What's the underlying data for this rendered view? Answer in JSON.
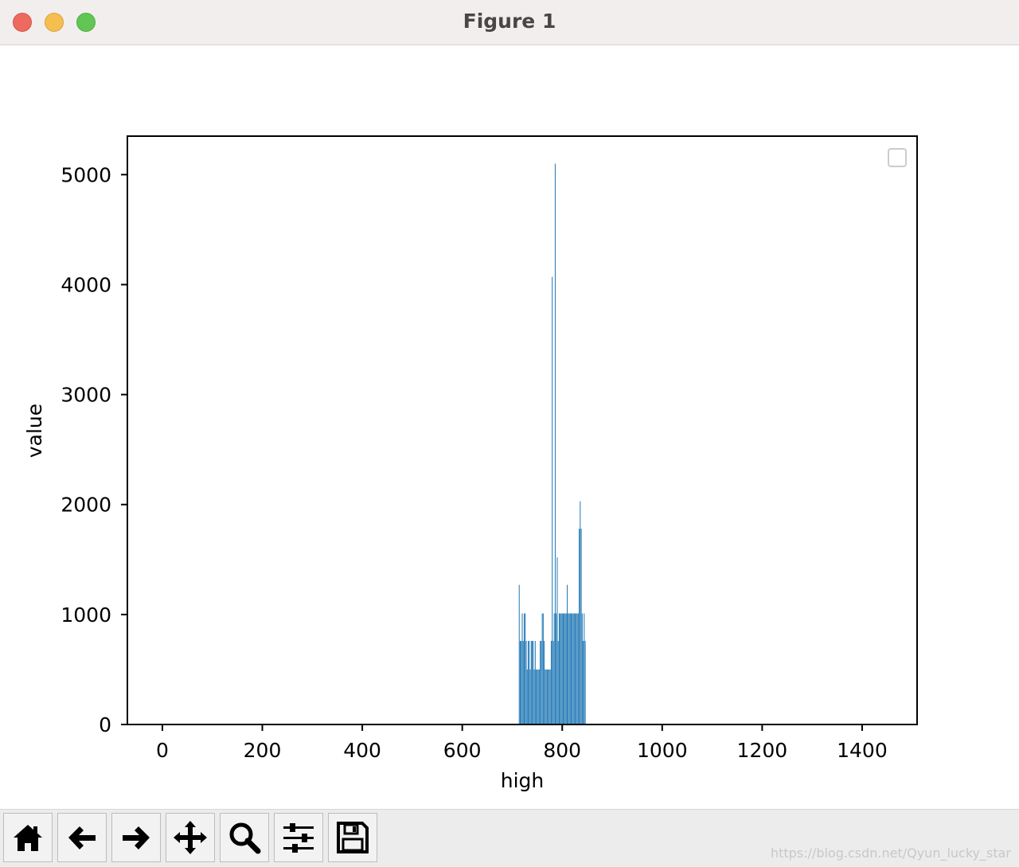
{
  "window": {
    "title": "Figure 1",
    "buttons": [
      "close",
      "minimize",
      "maximize"
    ]
  },
  "toolbar": {
    "tools": [
      {
        "name": "home-icon"
      },
      {
        "name": "back-icon"
      },
      {
        "name": "forward-icon"
      },
      {
        "name": "pan-icon"
      },
      {
        "name": "zoom-icon"
      },
      {
        "name": "subplots-config-icon"
      },
      {
        "name": "save-icon"
      }
    ]
  },
  "watermark": "https://blog.csdn.net/Qyun_lucky_star",
  "chart_data": {
    "type": "bar",
    "xlabel": "high",
    "ylabel": "value",
    "xlim": [
      -70,
      1510
    ],
    "ylim": [
      0,
      5350
    ],
    "xticks": [
      0,
      200,
      400,
      600,
      800,
      1000,
      1200,
      1400
    ],
    "yticks": [
      0,
      1000,
      2000,
      3000,
      4000,
      5000
    ],
    "legend": "top-right (empty)",
    "grid": false,
    "color": "#1f77b4",
    "x": [
      714,
      716,
      718,
      720,
      722,
      724,
      726,
      728,
      730,
      732,
      734,
      736,
      738,
      740,
      742,
      744,
      746,
      748,
      750,
      752,
      754,
      756,
      758,
      760,
      762,
      764,
      766,
      768,
      770,
      772,
      774,
      776,
      778,
      780,
      782,
      784,
      786,
      788,
      790,
      792,
      794,
      796,
      798,
      800,
      802,
      804,
      806,
      808,
      810,
      812,
      814,
      816,
      818,
      820,
      822,
      824,
      826,
      828,
      830,
      832,
      834,
      836,
      838,
      840,
      842,
      844,
      846
    ],
    "values": [
      1270,
      760,
      760,
      1010,
      760,
      1010,
      1010,
      760,
      500,
      760,
      760,
      500,
      760,
      760,
      760,
      500,
      760,
      500,
      500,
      500,
      500,
      760,
      760,
      1010,
      1010,
      760,
      500,
      500,
      500,
      500,
      500,
      500,
      760,
      4070,
      760,
      1010,
      5100,
      1010,
      1520,
      760,
      1010,
      1010,
      1010,
      1010,
      1010,
      1010,
      1010,
      1010,
      1270,
      1010,
      1010,
      1010,
      1010,
      1010,
      1010,
      1010,
      1010,
      1010,
      1010,
      1010,
      1780,
      2030,
      1780,
      1010,
      760,
      1010,
      760
    ]
  }
}
